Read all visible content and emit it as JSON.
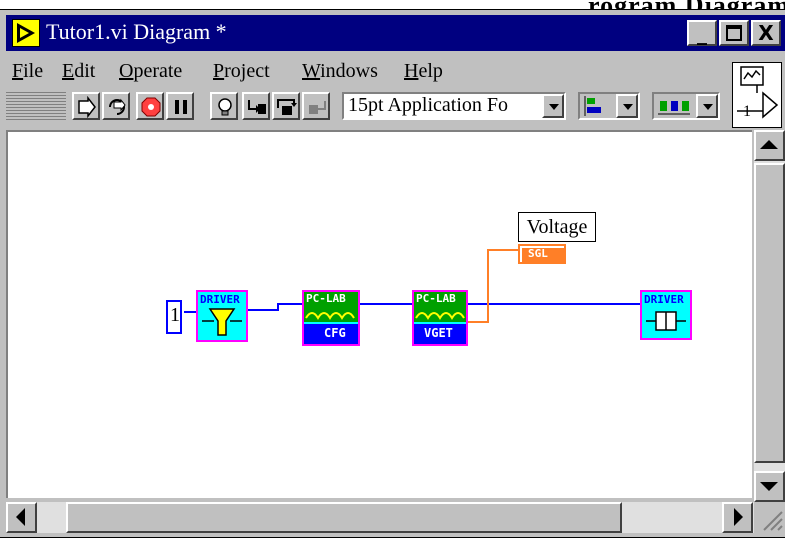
{
  "page_heading": "rogram Diagram",
  "window": {
    "title": "Tutor1.vi Diagram *",
    "controls": {
      "minimize": "_",
      "maximize": "□",
      "close": "X"
    }
  },
  "menubar": {
    "items": [
      {
        "label": "File",
        "accel": "F"
      },
      {
        "label": "Edit",
        "accel": "E"
      },
      {
        "label": "Operate",
        "accel": "O"
      },
      {
        "label": "Project",
        "accel": "P"
      },
      {
        "label": "Windows",
        "accel": "W"
      },
      {
        "label": "Help",
        "accel": "H"
      }
    ]
  },
  "toolbar": {
    "buttons": [
      "run-icon",
      "run-continuously-icon",
      "abort-icon",
      "pause-icon",
      "highlight-execution-icon",
      "step-into-icon",
      "step-over-icon",
      "step-out-icon"
    ],
    "font_dropdown": "15pt Application Fo"
  },
  "connector_pane": {
    "label": "1"
  },
  "diagram": {
    "constant": {
      "value": "1"
    },
    "nodes": [
      {
        "top": "DRIVER",
        "bottom": "",
        "fill": "#00ffff",
        "border": "#ff00ff"
      },
      {
        "top": "PC-LAB",
        "bottom": "CFG",
        "fill": "#00ffff",
        "border": "#ff00ff"
      },
      {
        "top": "PC-LAB",
        "bottom": "VGET",
        "fill": "#00ffff",
        "border": "#ff00ff"
      },
      {
        "top": "DRIVER",
        "bottom": "",
        "fill": "#00ffff",
        "border": "#ff00ff"
      }
    ],
    "indicator": {
      "label": "Voltage",
      "type": "SGL",
      "color": "#ff7f27"
    },
    "wire_color": "#0000ff"
  },
  "colors": {
    "titlebar": "#000080",
    "chrome": "#c0c0c0",
    "canvas": "#ffffff"
  }
}
